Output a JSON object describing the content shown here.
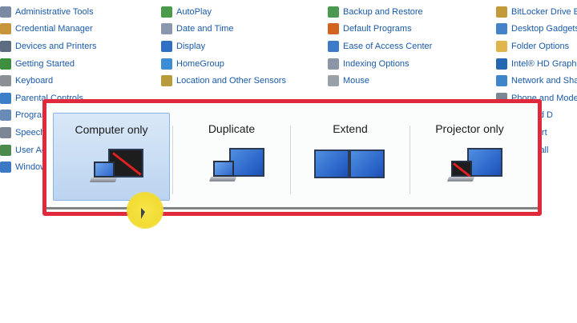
{
  "control_panel": {
    "columns": [
      [
        "Administrative Tools",
        "Credential Manager",
        "Devices and Printers",
        "Getting Started",
        "Keyboard",
        "Parental Controls",
        "Programs",
        "Speech Re",
        "User Acco",
        "Windows"
      ],
      [
        "AutoPlay",
        "Date and Time",
        "Display",
        "HomeGroup",
        "Location and Other Sensors"
      ],
      [
        "Backup and Restore",
        "Default Programs",
        "Ease of Access Center",
        "Indexing Options",
        "Mouse"
      ],
      [
        "BitLocker Drive En",
        "Desktop Gadgets",
        "Folder Options",
        "Intel® HD Graphic",
        "Network and Shar",
        "Phone and Moder",
        "App and D",
        "and Start",
        "s Firewall"
      ]
    ]
  },
  "projector_switcher": {
    "options": [
      {
        "label": "Computer only",
        "selected": true
      },
      {
        "label": "Duplicate",
        "selected": false
      },
      {
        "label": "Extend",
        "selected": false
      },
      {
        "label": "Projector only",
        "selected": false
      }
    ]
  },
  "colors": {
    "frame": "#e0293c",
    "selection": "#bcd4f0",
    "link": "#1a5aa8"
  }
}
